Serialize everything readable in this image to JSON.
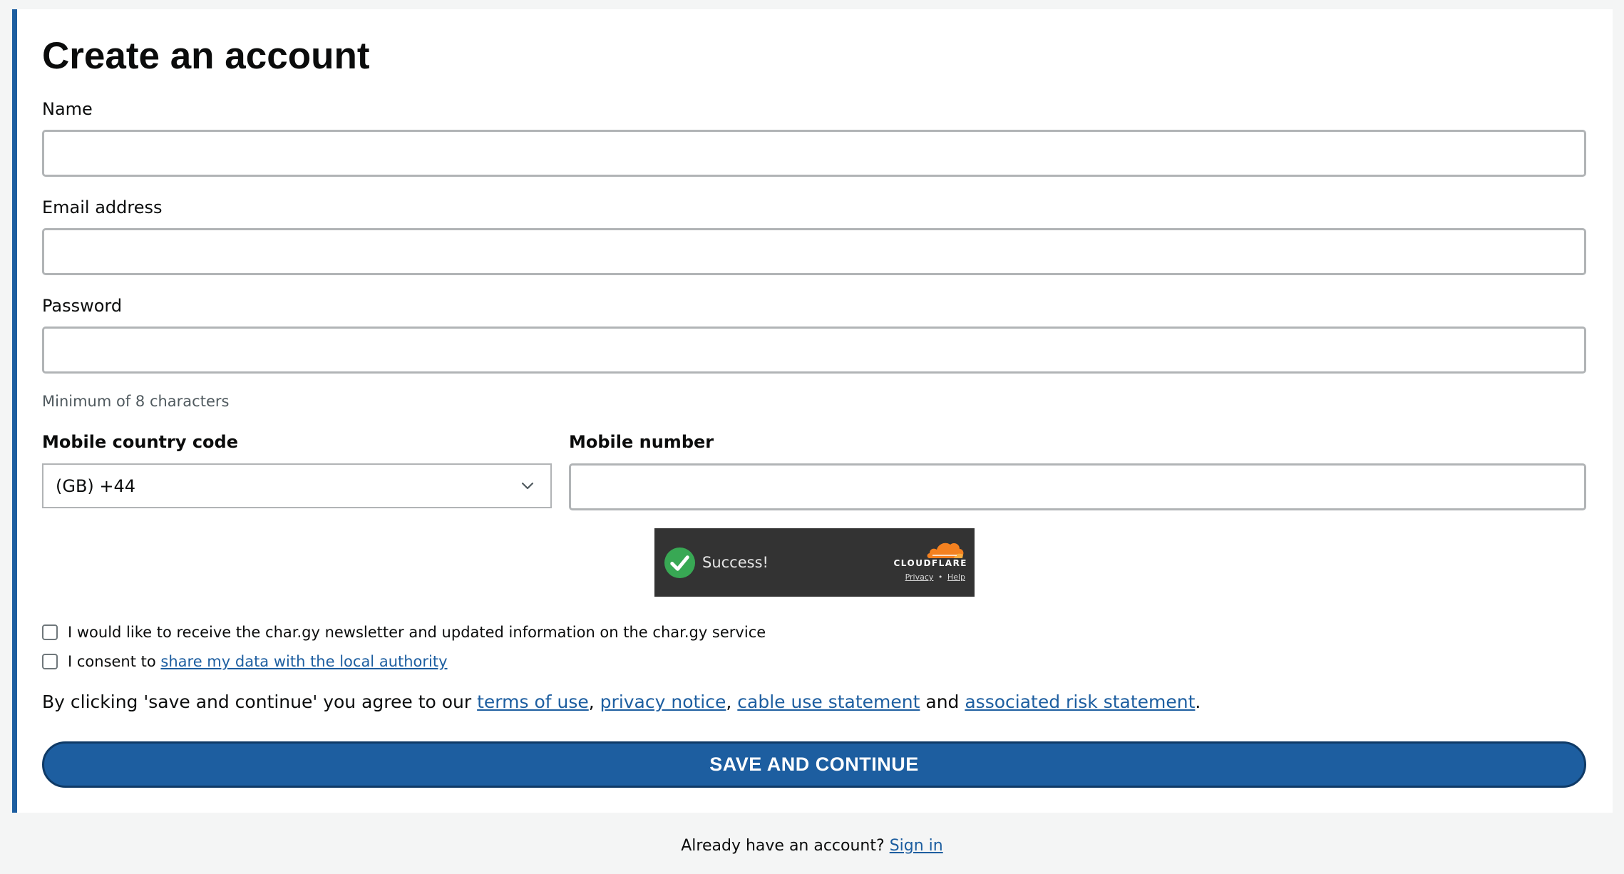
{
  "page": {
    "title": "Create an account"
  },
  "form": {
    "name_label": "Name",
    "name_value": "",
    "email_label": "Email address",
    "email_value": "",
    "password_label": "Password",
    "password_value": "",
    "password_hint": "Minimum of 8 characters",
    "country_code_label": "Mobile country code",
    "country_code_value": "(GB) +44",
    "mobile_label": "Mobile number",
    "mobile_value": ""
  },
  "captcha": {
    "status": "Success!",
    "brand": "CLOUDFLARE",
    "privacy_link": "Privacy",
    "separator": "•",
    "help_link": "Help",
    "check_icon": "check-circle-icon",
    "cloud_icon": "cloudflare-logo-icon"
  },
  "consents": {
    "newsletter_label": "I would like to receive the char.gy newsletter and updated information on the char.gy service",
    "newsletter_checked": false,
    "share_prefix": "I consent to ",
    "share_link": "share my data with the local authority",
    "share_checked": false
  },
  "agreement": {
    "prefix": "By clicking 'save and continue' you agree to our ",
    "terms_link": "terms of use",
    "sep1": ", ",
    "privacy_link": "privacy notice",
    "sep2": ", ",
    "cable_link": "cable use statement",
    "and": " and ",
    "risk_link": "associated risk statement",
    "end": "."
  },
  "actions": {
    "save_label": "SAVE AND CONTINUE"
  },
  "footer": {
    "prompt": "Already have an account? ",
    "signin_link": "Sign in"
  },
  "colors": {
    "accent": "#1d5ea0",
    "page_background": "#f4f5f5",
    "captcha_background": "#333333",
    "success_green": "#38a854",
    "cloudflare_orange": "#f48120"
  }
}
